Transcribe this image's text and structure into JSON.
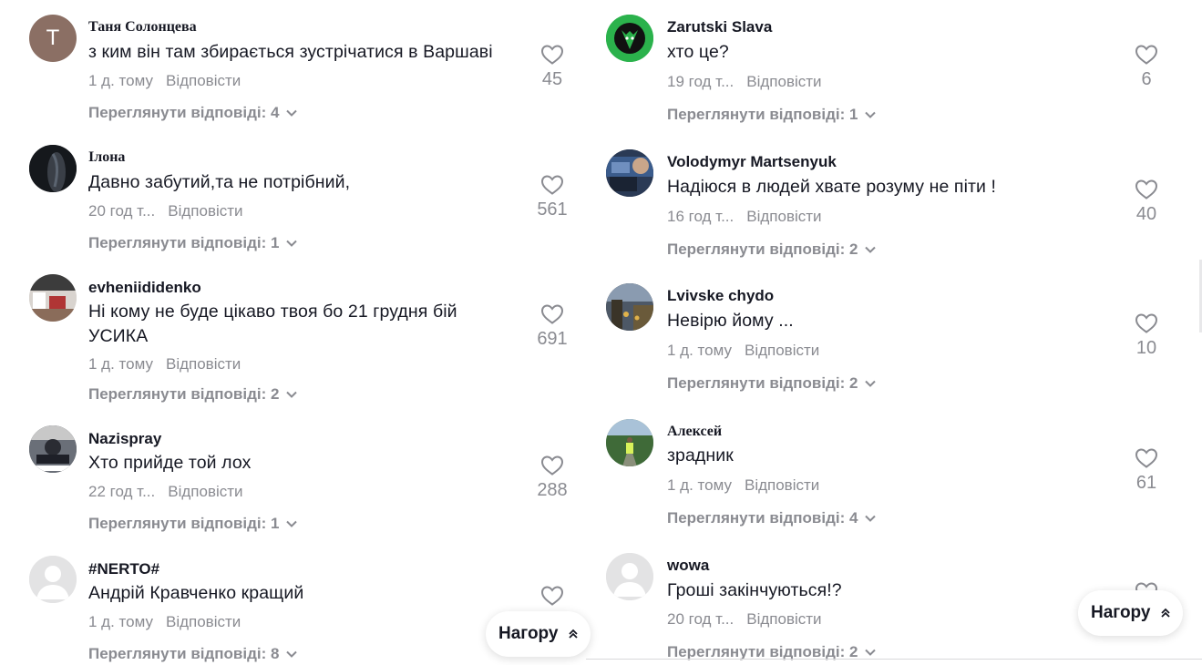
{
  "left_comments": [
    {
      "username": "Таня Солонцева",
      "avatar": "letter-T",
      "avatar_letter": "T",
      "avatar_color": "#8b6f64",
      "text": "з ким він там збирається зустрічатися в Варшаві",
      "time": "1 д. тому",
      "reply": "Відповісти",
      "likes": "45",
      "view_replies": "Переглянути відповіді: 4"
    },
    {
      "username": "Ілона",
      "avatar": "photo-dark",
      "text": "Давно забутий,та не потрібний,",
      "time": "20 год т...",
      "reply": "Відповісти",
      "likes": "561",
      "view_replies": "Переглянути відповіді: 1"
    },
    {
      "username": "evheniididenko",
      "avatar": "photo-room",
      "text": "Ні кому не буде цікаво твоя бо 21 грудня бій УСИКА",
      "time": "1 д. тому",
      "reply": "Відповісти",
      "likes": "691",
      "view_replies": "Переглянути відповіді: 2"
    },
    {
      "username": "Nazispray",
      "avatar": "photo-bike",
      "text": "Хто прийде той лох",
      "time": "22 год т...",
      "reply": "Відповісти",
      "likes": "288",
      "view_replies": "Переглянути відповіді: 1"
    },
    {
      "username": "#NERTO#",
      "avatar": "default",
      "text": "Андрій Кравченко кращий",
      "time": "1 д. тому",
      "reply": "Відповісти",
      "likes": "",
      "view_replies": "Переглянути відповіді: 8"
    }
  ],
  "right_comments": [
    {
      "username": "Zarutski Slava",
      "avatar": "logo-wolf",
      "text": "хто це?",
      "time": "19 год т...",
      "reply": "Відповісти",
      "likes": "6",
      "view_replies": "Переглянути відповіді: 1"
    },
    {
      "username": "Volodymyr Martsenyuk",
      "avatar": "photo-truck",
      "text": "Надіюся в людей хвате розуму не піти !",
      "time": "16 год т...",
      "reply": "Відповісти",
      "likes": "40",
      "view_replies": "Переглянути відповіді: 2"
    },
    {
      "username": "Lvivske chydo",
      "avatar": "photo-street",
      "text": "Невірю йому ...",
      "time": "1 д. тому",
      "reply": "Відповісти",
      "likes": "10",
      "view_replies": "Переглянути відповіді: 2"
    },
    {
      "username": "Алексей",
      "avatar": "photo-park",
      "text": "зрадник",
      "time": "1 д. тому",
      "reply": "Відповісти",
      "likes": "61",
      "view_replies": "Переглянути відповіді: 4"
    },
    {
      "username": "wowa",
      "avatar": "default",
      "text": "Гроші закінчуються!?",
      "time": "20 год т...",
      "reply": "Відповісти",
      "likes": "",
      "view_replies": "Переглянути відповіді: 2"
    }
  ],
  "buttons": {
    "back_to_top_left": "Нагору",
    "back_to_top_right": "Нагору"
  },
  "colors": {
    "text_primary": "#161823",
    "text_secondary": "#8a8b91"
  }
}
